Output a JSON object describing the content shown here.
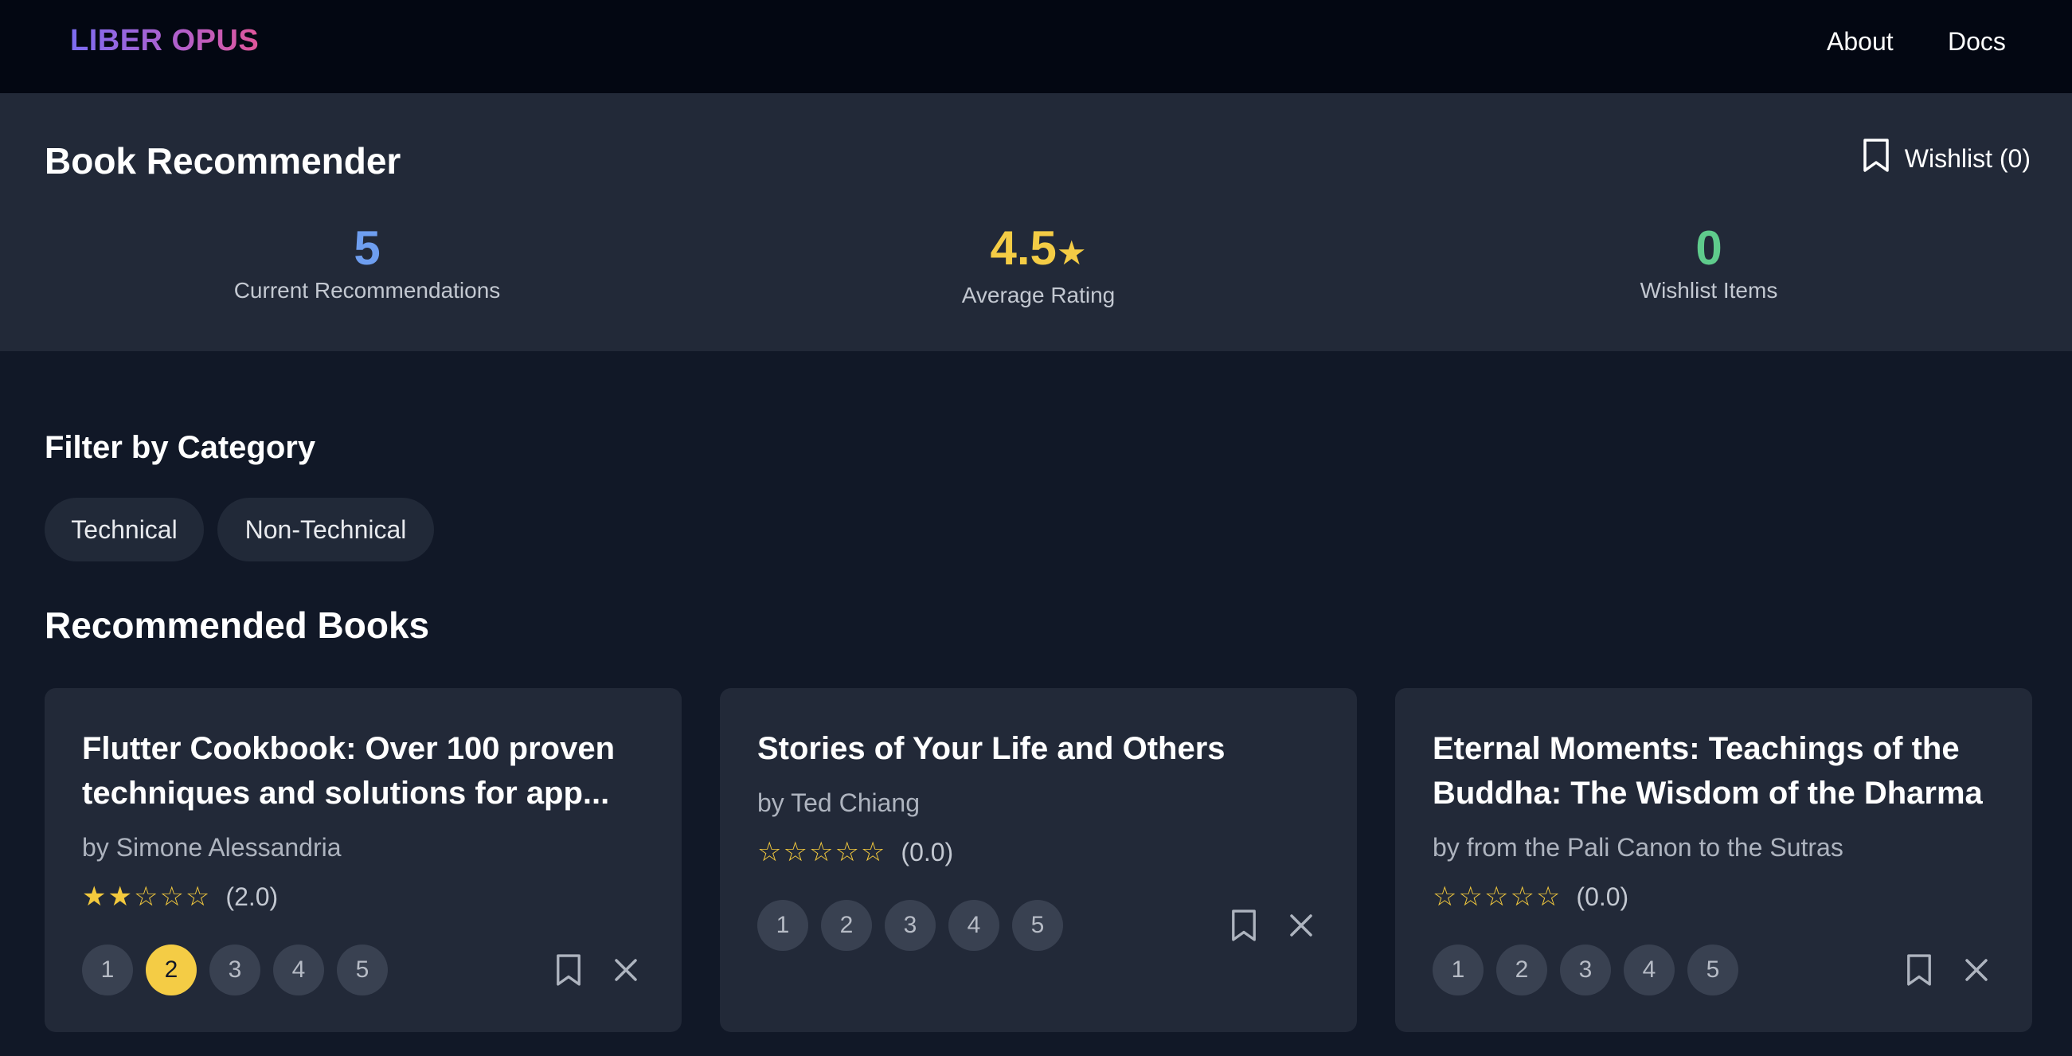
{
  "nav": {
    "brand": "LIBER OPUS",
    "links": [
      "About",
      "Docs"
    ]
  },
  "header": {
    "title": "Book Recommender",
    "wishlist_button": "Wishlist (0)",
    "stats": [
      {
        "value": "5",
        "label": "Current Recommendations",
        "color": "#6e9ef0"
      },
      {
        "value": "4.5",
        "suffix": "★",
        "label": "Average Rating",
        "color": "#f4cc45"
      },
      {
        "value": "0",
        "label": "Wishlist Items",
        "color": "#5fcb8c"
      }
    ]
  },
  "filters": {
    "title": "Filter by Category",
    "options": [
      "Technical",
      "Non-Technical"
    ]
  },
  "recommendations": {
    "title": "Recommended Books",
    "rating_options": [
      "1",
      "2",
      "3",
      "4",
      "5"
    ],
    "books": [
      {
        "title": "Flutter Cookbook: Over 100 proven techniques and solutions for app...",
        "author": "by Simone Alessandria",
        "stars": "★★☆☆☆",
        "rating": "(2.0)",
        "selected_rating": 2
      },
      {
        "title": "Stories of Your Life and Others",
        "author": "by Ted Chiang",
        "stars": "☆☆☆☆☆",
        "rating": "(0.0)",
        "selected_rating": 0
      },
      {
        "title": "Eternal Moments: Teachings of the Buddha: The Wisdom of the Dharma",
        "author": "by from the Pali Canon to the Sutras",
        "stars": "☆☆☆☆☆",
        "rating": "(0.0)",
        "selected_rating": 0
      }
    ]
  },
  "icons": {
    "wishlist": "bookmark-icon",
    "save": "bookmark-icon",
    "dismiss": "close-icon"
  },
  "colors": {
    "star": "#f3c93d",
    "active_rating": "#f4cc45"
  }
}
